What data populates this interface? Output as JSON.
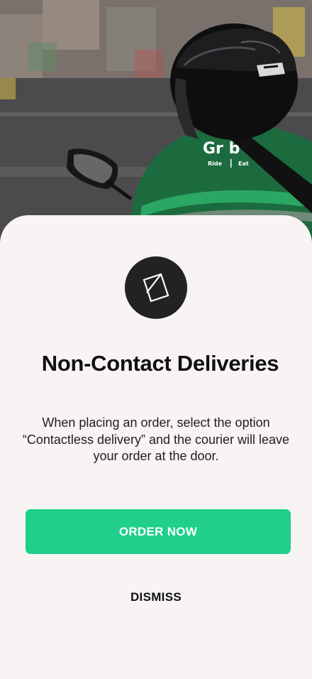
{
  "hero": {
    "image": "courier-on-motorbike-photo",
    "jacket_text": "Gr b",
    "jacket_labels": [
      "Ride",
      "Eat"
    ]
  },
  "modal": {
    "icon": "non-contact-icon",
    "title": "Non-Contact Deliveries",
    "description": "When placing an order, select the option “Contactless delivery” and the courier will leave your order at the door.",
    "primary_button": "ORDER NOW",
    "secondary_button": "DISMISS"
  },
  "colors": {
    "accent": "#1fcf8a",
    "background": "#f8f4f3",
    "icon_circle": "#222222",
    "jacket_green": "#1b6b3e"
  }
}
